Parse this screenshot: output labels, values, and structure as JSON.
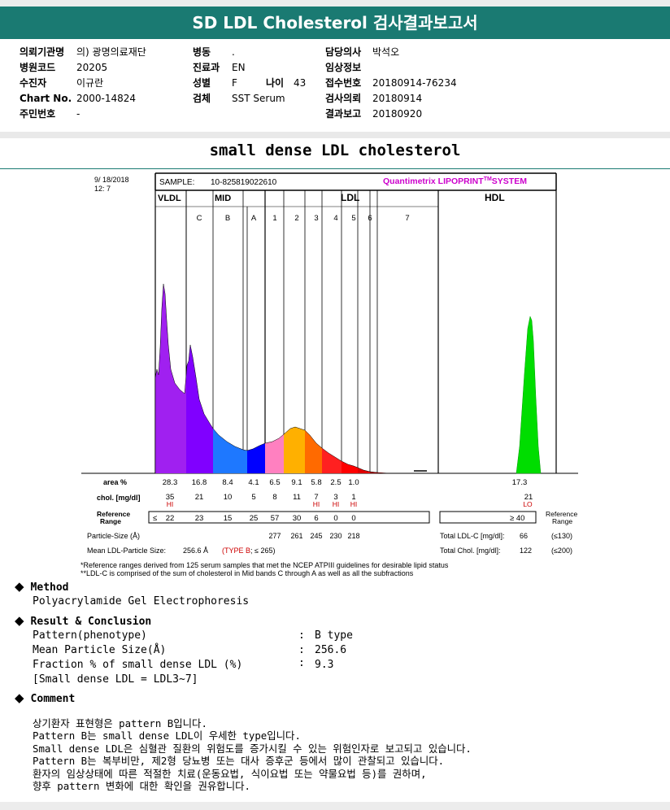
{
  "header": {
    "title": "SD LDL Cholesterol 검사결과보고서"
  },
  "info": {
    "inst_label": "의뢰기관명",
    "inst_value": "의) 광명의료재단",
    "code_label": "병원코드",
    "code_value": "20205",
    "patient_label": "수진자",
    "patient_value": "이규란",
    "chart_label": "Chart No.",
    "chart_value": "2000-14824",
    "id_label": "주민번호",
    "id_value": "-",
    "ward_label": "병동",
    "ward_value": ".",
    "dept_label": "진료과",
    "dept_value": "EN",
    "sex_label": "성별",
    "sex_value": "F",
    "age_label": "나이",
    "age_value": "43",
    "specimen_label": "검체",
    "specimen_value": "SST Serum",
    "doctor_label": "담당의사",
    "doctor_value": "박석오",
    "clinical_label": "임상정보",
    "receipt_label": "접수번호",
    "receipt_value": "20180914-76234",
    "request_label": "검사의뢰",
    "request_value": "20180914",
    "report_label": "결과보고",
    "report_value": "20180920"
  },
  "subtitle": "small dense LDL cholesterol",
  "report": {
    "date": "9/ 18/2018",
    "time": "12: 7",
    "sample_label": "SAMPLE:",
    "sample_id": "10-825819022610",
    "brand": "Quantimetrix LIPOPRINT",
    "brand_tm": "TM",
    "brand_system": "SYSTEM",
    "group_vldl": "VLDL",
    "group_mid": "MID",
    "group_ldl": "LDL",
    "group_hdl": "HDL",
    "band_labels": [
      "C",
      "B",
      "A",
      "1",
      "2",
      "3",
      "4",
      "5",
      "6",
      "7"
    ],
    "row_area_label": "area %",
    "area_values": [
      "28.3",
      "16.8",
      "8.4",
      "4.1",
      "6.5",
      "9.1",
      "5.8",
      "2.5",
      "1.0"
    ],
    "hdl_area": "17.3",
    "row_chol_label": "chol. [mg/dl]",
    "chol_values": [
      "35",
      "21",
      "10",
      "5",
      "8",
      "11",
      "7",
      "3",
      "1"
    ],
    "hdl_chol": "21",
    "flag_hi": "HI",
    "flag_lo": "LO",
    "row_ref_label_1": "Reference",
    "row_ref_label_2": "Range",
    "ref_le": "≤",
    "ref_values": [
      "22",
      "23",
      "15",
      "25",
      "57",
      "30",
      "6",
      "0",
      "0"
    ],
    "hdl_ref": "≥ 40",
    "ref_right_1": "Reference",
    "ref_right_2": "Range",
    "particle_label": "Particle-Size (Å)",
    "particle_values": [
      "277",
      "261",
      "245",
      "230",
      "218"
    ],
    "total_ldl_label": "Total LDL-C [mg/dl]:",
    "total_ldl_value": "66",
    "total_ldl_ref": "(≤130)",
    "mean_label": "Mean LDL-Particle Size:",
    "mean_value": "256.6 Å",
    "type_text": "(TYPE B",
    "type_ref": "; ≤ 265)",
    "total_chol_label": "Total Chol. [mg/dl]:",
    "total_chol_value": "122",
    "total_chol_ref": "(≤200)"
  },
  "footnotes": {
    "line1": "*Reference ranges derived from 125 serum samples that met the NCEP ATPIII guidelines for desirable lipid status",
    "line2": "**LDL-C is comprised of the sum of cholesterol in Mid bands C through A as well as all the subfractions"
  },
  "method": {
    "heading": "Method",
    "text": "Polyacrylamide Gel Electrophoresis"
  },
  "result": {
    "heading": "Result & Conclusion",
    "row1_label": "Pattern(phenotype)",
    "row1_colon": ":",
    "row1_value": "B type",
    "row2_label": "Mean Particle Size(Å)",
    "row2_colon": ":",
    "row2_value": "256.6",
    "row3_label": "Fraction % of small dense LDL (%)",
    "row3_colon": ":",
    "row3_value": "9.3",
    "row4_label": "[Small dense LDL = LDL3~7]"
  },
  "comment": {
    "heading": "Comment",
    "lines": [
      "상기환자 표현형은 pattern B입니다.",
      "Pattern B는 small dense LDL이 우세한 type입니다.",
      "Small dense LDL은 심혈관 질환의 위험도를 증가시킬 수 있는 위험인자로 보고되고 있습니다.",
      "Pattern B는 복부비만, 제2형 당뇨병 또는 대사 증후군 등에서 많이 관찰되고 있습니다.",
      "환자의 임상상태에 따른 적절한 치료(운동요법, 식이요법 또는 약물요법 등)를 권하며,",
      "향후 pattern 변화에 대한 확인을 권유합니다."
    ]
  },
  "colors": {
    "banner": "#1a7a72",
    "hi_flag": "#cc0000",
    "brand": "#cc00cc",
    "vldl": "#a020f0",
    "mid_c": "#8000ff",
    "mid_b": "#1e78ff",
    "mid_a": "#0000ff",
    "ldl1": "#ff80c0",
    "ldl2": "#ffb000",
    "ldl3": "#ff6a00",
    "ldl4": "#ff2020",
    "ldl5": "#ff0000",
    "ldl6": "#e00000",
    "ldl7": "#aa0000",
    "hdl": "#00dd00"
  }
}
